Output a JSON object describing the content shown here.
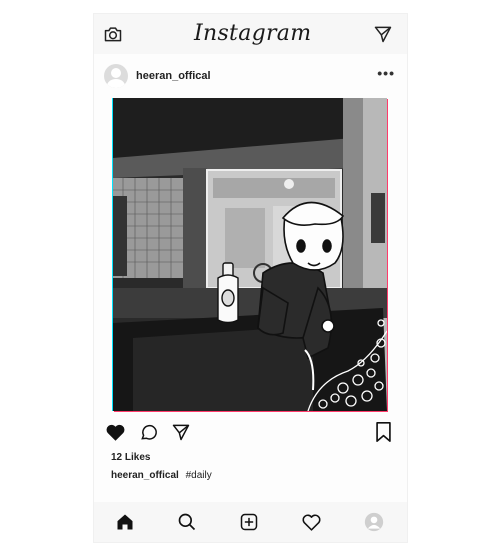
{
  "app": {
    "brand": "Instagram"
  },
  "topbar": {
    "camera_icon": "camera-icon",
    "send_icon": "paper-plane-icon"
  },
  "post": {
    "username": "heeran_offical",
    "more_label": "•••",
    "likes_text": "12 Likes",
    "caption_user": "heeran_offical",
    "caption_tag": "#daily",
    "liked": true
  },
  "bottom_nav": {
    "items": [
      "home-icon",
      "search-icon",
      "add-post-icon",
      "activity-heart-icon",
      "profile-avatar-icon"
    ]
  },
  "colors": {
    "text": "#111111",
    "bar_bg": "#f7f7f7",
    "chromatic_left": "#00e5ff",
    "chromatic_right": "#ff3b6b"
  }
}
